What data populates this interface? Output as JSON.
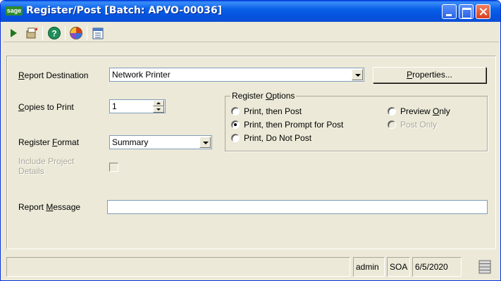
{
  "window": {
    "title": "Register/Post [Batch: APVO-00036]",
    "logo_text": "sage"
  },
  "toolbar": {
    "items": [
      "run-icon",
      "export-icon",
      "help-icon",
      "customize-icon",
      "calendar-icon"
    ]
  },
  "form": {
    "report_destination": {
      "label_accesskey": "R",
      "label_rest": "eport Destination",
      "value": "Network Printer"
    },
    "properties_button": {
      "accesskey": "P",
      "rest": "roperties..."
    },
    "copies": {
      "label_accesskey": "C",
      "label_rest": "opies to Print",
      "value": "1"
    },
    "register_format": {
      "label_prefix": "Register ",
      "label_accesskey": "F",
      "label_rest": "ormat",
      "value": "Summary"
    },
    "include_project_details": {
      "label_line1": "Include Project",
      "label_line2": "Details",
      "checked": false
    },
    "report_message": {
      "label_prefix": "Report ",
      "label_accesskey": "M",
      "label_rest": "essage",
      "value": ""
    }
  },
  "register_options": {
    "legend_prefix": "Register ",
    "legend_accesskey": "O",
    "legend_rest": "ptions",
    "options": [
      {
        "label": "Print, then Post",
        "checked": false,
        "disabled": false
      },
      {
        "label": "Print, then Prompt for Post",
        "checked": true,
        "disabled": false
      },
      {
        "label": "Print, Do Not Post",
        "checked": false,
        "disabled": false
      },
      {
        "label_prefix": "Preview ",
        "label_accesskey": "O",
        "label_rest": "nly",
        "checked": false,
        "disabled": false
      },
      {
        "label": "Post Only",
        "checked": false,
        "disabled": true
      }
    ]
  },
  "statusbar": {
    "message": "",
    "user": "admin",
    "company": "SOA",
    "date": "6/5/2020"
  },
  "colors": {
    "titlebar": "#0a5fe8",
    "window_bg": "#ece9d8",
    "disabled_text": "#aca899"
  }
}
